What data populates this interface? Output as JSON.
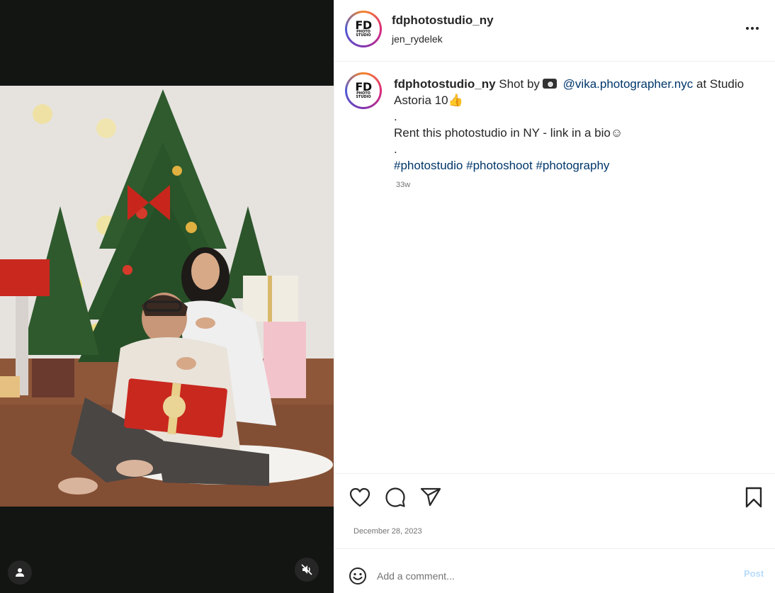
{
  "header": {
    "username": "fdphotostudio_ny",
    "subname": "jen_rydelek",
    "avatar_text": "FD",
    "avatar_subtext": "PHOTO STUDIO"
  },
  "caption": {
    "username": "fdphotostudio_ny",
    "shot_by": "Shot by",
    "mention": "@vika.photographer.nyc",
    "at_text": "at",
    "location": "Studio Astoria 10",
    "thumb_emoji": "👍",
    "dot1": ".",
    "rent_text": "Rent this photostudio in NY - link in a bio",
    "smile_emoji": "☺",
    "dot2": ".",
    "hashtags": [
      "#photostudio",
      "#photoshoot",
      "#photography"
    ],
    "time_ago": "33w"
  },
  "post": {
    "date": "December 28, 2023"
  },
  "comment_box": {
    "placeholder": "Add a comment...",
    "post_label": "Post"
  },
  "icons": {
    "more": "more-options-icon",
    "like": "heart-icon",
    "comment": "comment-icon",
    "share": "send-icon",
    "save": "bookmark-icon",
    "emoji": "emoji-icon",
    "user_tags": "user-icon",
    "mute": "speaker-muted-icon"
  },
  "colors": {
    "link": "#00376b",
    "post_button_disabled": "#b8dbfc",
    "secondary_text": "#737373",
    "media_bg": "#121512"
  }
}
